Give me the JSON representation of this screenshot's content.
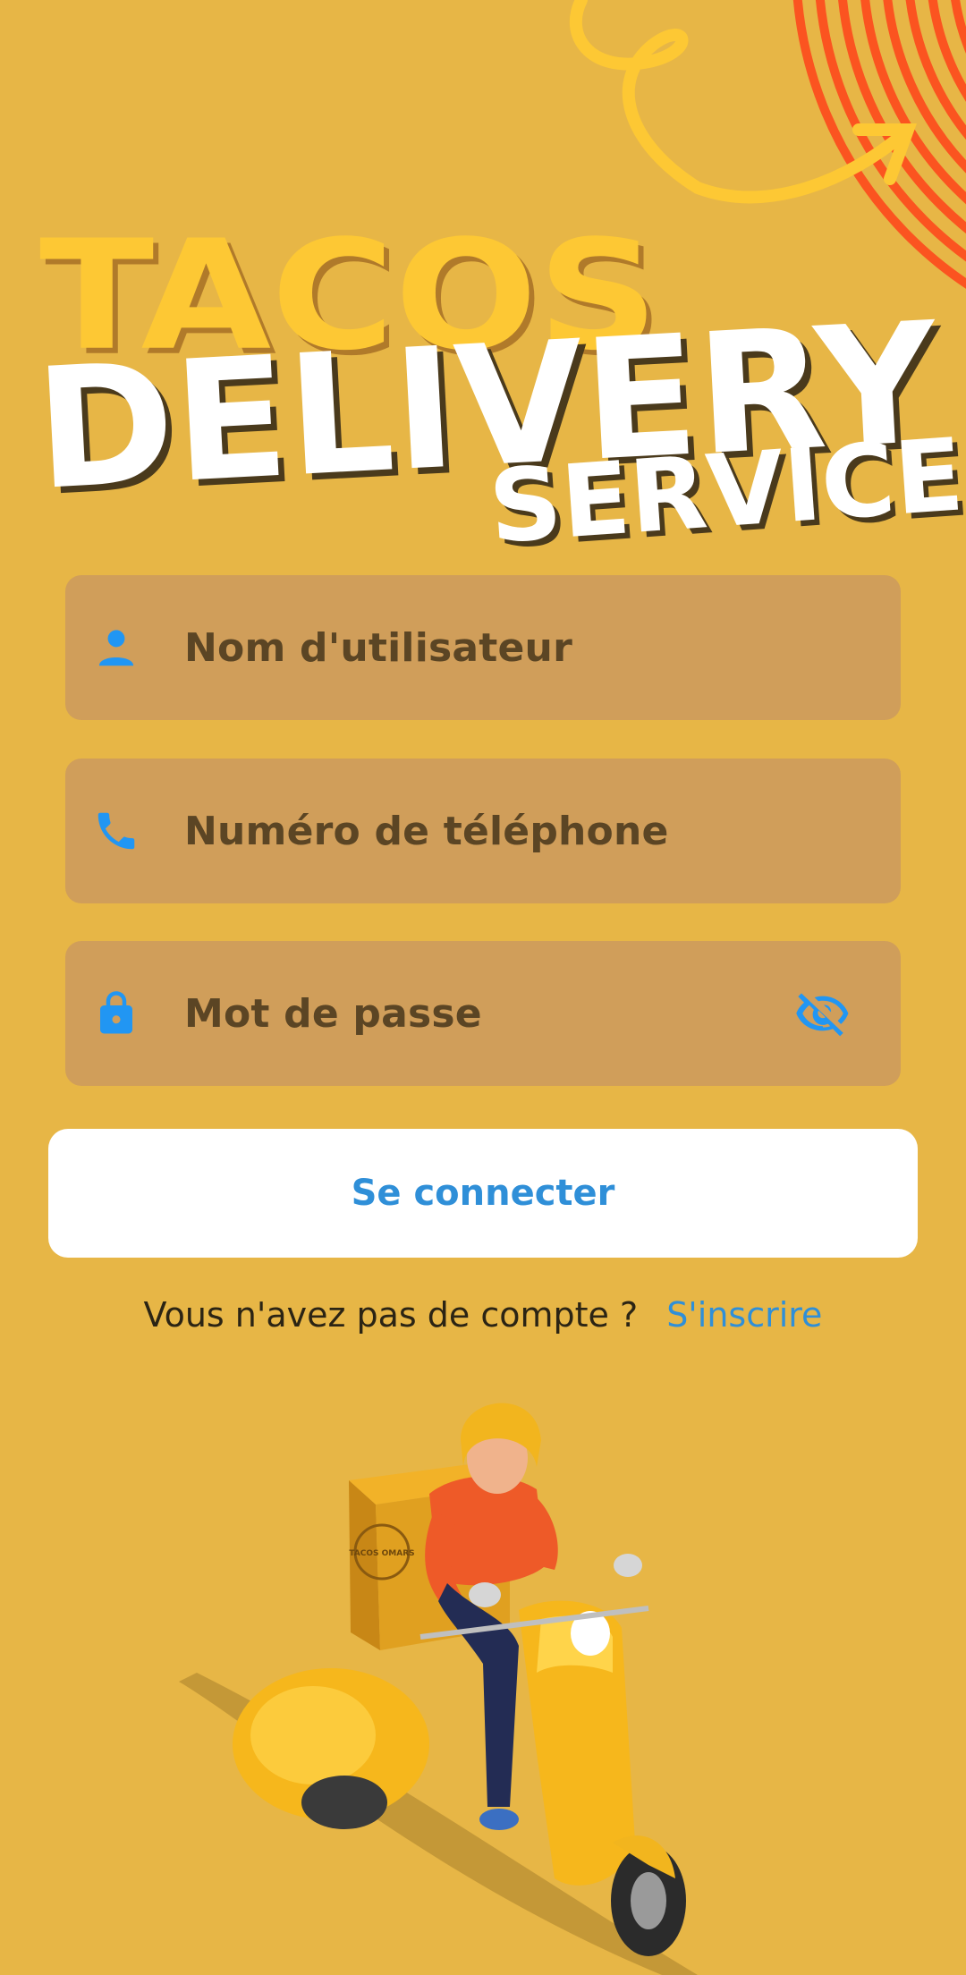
{
  "hero": {
    "line1": "TACOS",
    "line2": "DELIVERY",
    "line3": "SERVICE"
  },
  "form": {
    "username_placeholder": "Nom d'utilisateur",
    "phone_placeholder": "Numéro de téléphone",
    "password_placeholder": "Mot de passe"
  },
  "actions": {
    "login_label": "Se connecter",
    "no_account_text": "Vous n'avez pas de compte ?",
    "signup_label": "S'inscrire"
  },
  "icons": {
    "username": "person-icon",
    "phone": "phone-icon",
    "password": "lock-icon",
    "toggle_visibility": "eye-off-icon"
  },
  "colors": {
    "background": "#e7b646",
    "field": "#d09e5a",
    "accent": "#2f8fd8",
    "title_yellow": "#fdc834",
    "stripes": "#fb5420"
  },
  "illustration": {
    "box_logo": "TACOS OMARS"
  }
}
